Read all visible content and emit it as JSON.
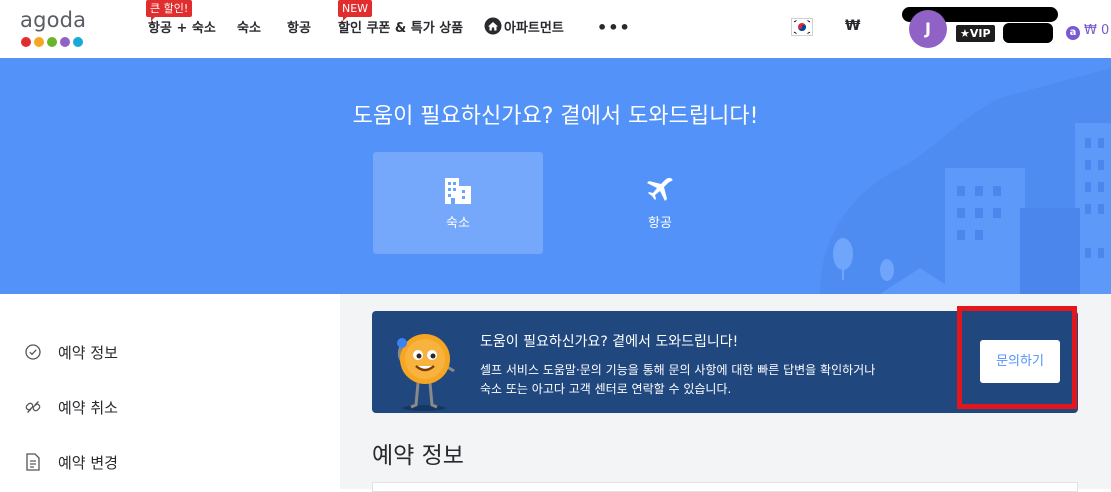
{
  "header": {
    "logo_text": "agoda",
    "logo_dot_colors": [
      "#e12d2d",
      "#f5a623",
      "#69b62c",
      "#9162c6",
      "#18a9d8"
    ],
    "nav": [
      {
        "label": "항공 + 숙소",
        "badge": "큰 할인!"
      },
      {
        "label": "숙소",
        "badge": ""
      },
      {
        "label": "항공",
        "badge": ""
      },
      {
        "label": "할인 쿠폰 & 특가 상품",
        "badge": "NEW"
      },
      {
        "label": "아파트먼트",
        "badge": "",
        "icon": "home-icon"
      }
    ],
    "more_label": "•••",
    "currency": "₩",
    "avatar_initial": "J",
    "vip_label": "VIP",
    "points": "₩ 0"
  },
  "hero": {
    "title": "도움이 필요하신가요? 곁에서 도와드립니다!",
    "tabs": [
      {
        "label": "숙소",
        "icon": "hotel-building-icon",
        "active": true
      },
      {
        "label": "항공",
        "icon": "airplane-icon",
        "active": false
      }
    ]
  },
  "sidebar": {
    "items": [
      {
        "label": "예약 정보",
        "icon": "check-circle-icon"
      },
      {
        "label": "예약 취소",
        "icon": "broken-link-icon"
      },
      {
        "label": "예약 변경",
        "icon": "document-icon"
      }
    ]
  },
  "banner": {
    "title": "도움이 필요하신가요? 곁에서 도와드립니다!",
    "line1": "셀프 서비스 도움말·문의 기능을 통해 문의 사항에 대한 빠른 답변을 확인하거나",
    "line2": "숙소 또는 아고다 고객 센터로 연락할 수 있습니다.",
    "button_label": "문의하기"
  },
  "main": {
    "section_title": "예약 정보"
  },
  "colors": {
    "brand_blue": "#5392f9",
    "banner_navy": "#20477e",
    "highlight_red": "#e3161c",
    "avatar_purple": "#9162c6"
  }
}
